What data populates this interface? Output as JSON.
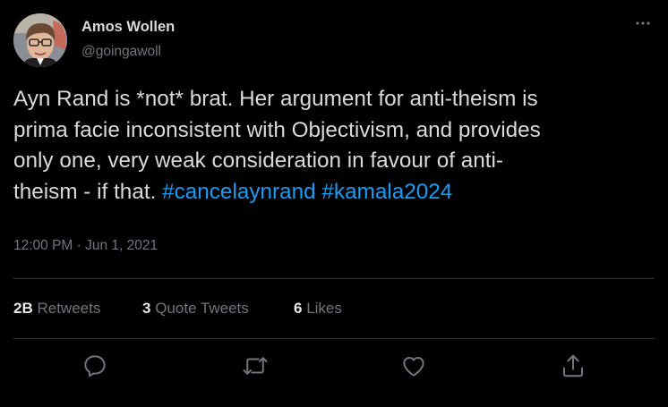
{
  "author": {
    "display_name": "Amos Wollen",
    "handle": "@goingawoll",
    "avatar_icon": "profile-photo-avatar"
  },
  "tweet": {
    "line1": "Ayn Rand is *not* brat. Her argument for anti-theism is",
    "line2": "prima facie inconsistent with Objectivism, and provides",
    "line3": "only one, very weak consideration in favour of anti-",
    "line4_text": "theism - if that. ",
    "hashtag1": "#cancelaynrand",
    "hashtag_sep": " ",
    "hashtag2": "#kamala2024"
  },
  "timestamp": "12:00 PM · Jun 1, 2021",
  "stats": {
    "retweets_count": "2B",
    "retweets_label": "Retweets",
    "quote_count": "3",
    "quote_label": "Quote Tweets",
    "likes_count": "6",
    "likes_label": "Likes"
  },
  "actions": {
    "reply_icon": "reply-icon",
    "retweet_icon": "retweet-icon",
    "like_icon": "like-icon",
    "share_icon": "share-icon"
  },
  "colors": {
    "background": "#000000",
    "text": "#d9d9d9",
    "secondary": "#71767b",
    "link": "#1d9bf0",
    "divider": "#2f3336"
  }
}
